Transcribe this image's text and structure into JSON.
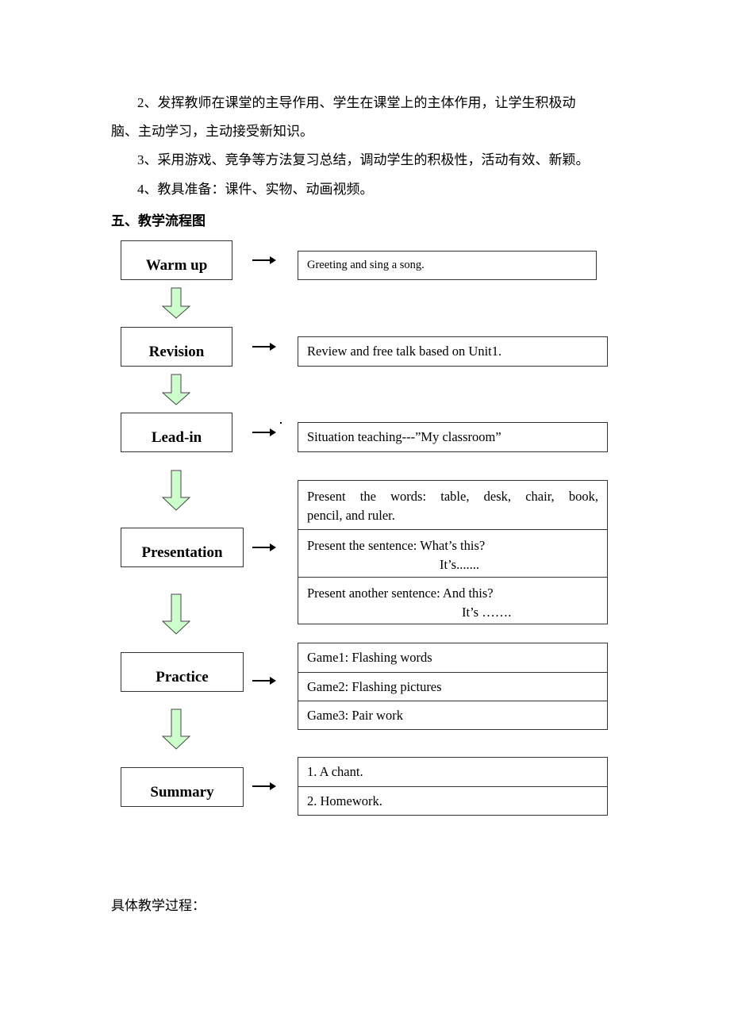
{
  "paragraphs": [
    "2、发挥教师在课堂的主导作用、学生在课堂上的主体作用，让学生积极动",
    "脑、主动学习，主动接受新知识。",
    "3、采用游戏、竞争等方法复习总结，调动学生的积极性，活动有效、新颖。",
    "4、教具准备：课件、实物、动画视频。"
  ],
  "section_heading": "五、教学流程图",
  "flowchart": {
    "arrow_color": "#ccffcc",
    "stages": [
      {
        "label": "Warm up",
        "details": [
          "Greeting and sing a song."
        ]
      },
      {
        "label": "Revision",
        "details": [
          "Review and free talk based on Unit1."
        ]
      },
      {
        "label": "Lead-in",
        "details": [
          "Situation teaching---”My classroom”"
        ]
      },
      {
        "label": "Presentation",
        "details": [
          {
            "line1": "Present the words: table, desk, chair, book,",
            "line2": "pencil, and ruler."
          },
          {
            "line1": "Present the sentence: What’s this?",
            "line2": "It’s......."
          },
          {
            "line1": "Present another sentence: And this?",
            "line2": "It’s ……."
          }
        ]
      },
      {
        "label": "Practice",
        "details": [
          "Game1: Flashing words",
          "Game2: Flashing pictures",
          "Game3: Pair work"
        ]
      },
      {
        "label": "Summary",
        "details": [
          "1. A chant.",
          "2. Homework."
        ]
      }
    ]
  },
  "footer_text": "具体教学过程："
}
